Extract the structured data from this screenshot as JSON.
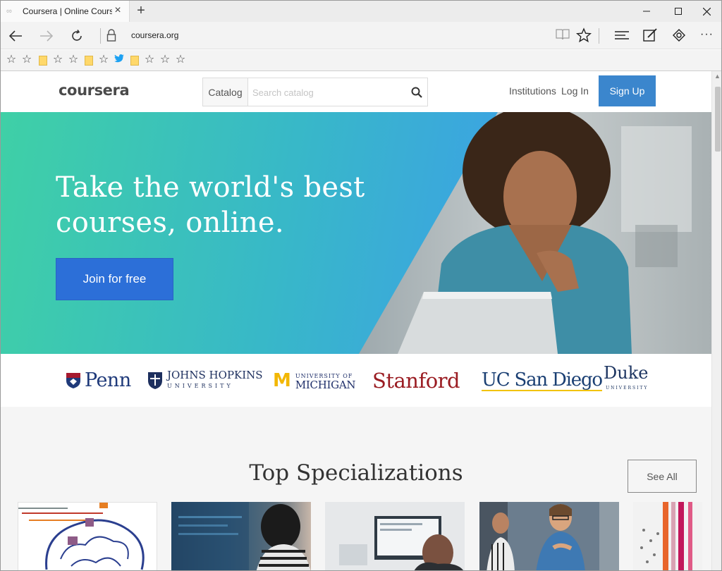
{
  "browser": {
    "tab_title": "Coursera | Online Cours",
    "address": "coursera.org",
    "new_tab_symbol": "+",
    "favorites_bar": [
      "star-icon",
      "star-icon",
      "folder-icon",
      "star-icon",
      "star-icon",
      "folder-icon",
      "star-icon",
      "twitter-icon",
      "folder-icon",
      "star-icon",
      "star-icon",
      "star-icon"
    ]
  },
  "header": {
    "logo": "coursera",
    "catalog_label": "Catalog",
    "search_placeholder": "Search catalog",
    "institutions_label": "Institutions",
    "login_label": "Log In",
    "signup_label": "Sign Up"
  },
  "hero": {
    "title_line1": "Take the world's best",
    "title_line2": "courses, online.",
    "cta_label": "Join for free"
  },
  "partners": {
    "penn": "Penn",
    "jhu_main": "JOHNS HOPKINS",
    "jhu_sub": "UNIVERSITY",
    "umich_small": "UNIVERSITY OF",
    "umich_big": "MICHIGAN",
    "stanford": "Stanford",
    "ucsd": "UC San Diego",
    "duke": "Duke",
    "duke_sub": "UNIVERSITY"
  },
  "specializations": {
    "title": "Top Specializations",
    "see_all_label": "See All"
  },
  "colors": {
    "signup_blue": "#3b86cd",
    "join_blue": "#2c6fd8",
    "hero_gradient_start": "#3fd0a6",
    "hero_gradient_end": "#3ba6df"
  }
}
